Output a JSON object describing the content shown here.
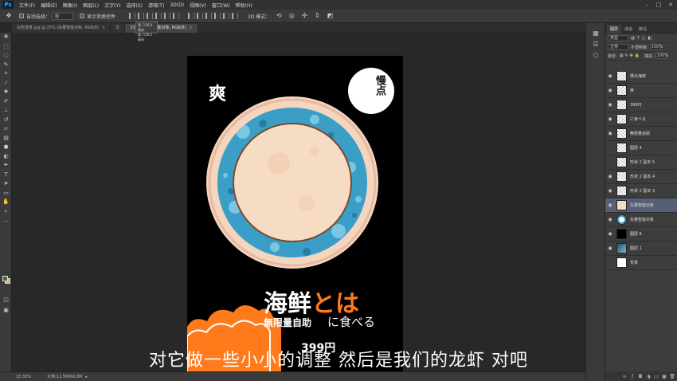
{
  "app": {
    "logo": "Ps"
  },
  "menu": [
    "文件(F)",
    "编辑(E)",
    "图像(I)",
    "图层(L)",
    "文字(Y)",
    "选择(S)",
    "滤镜(T)",
    "3D(D)",
    "视图(V)",
    "窗口(W)",
    "帮助(H)"
  ],
  "options": {
    "auto_select_label": "自动选择：",
    "auto_select_value": "组",
    "show_transform_label": "显示变换控件",
    "mode_3d_label": "3D 模式："
  },
  "tabs": [
    {
      "label": "白色背景.jpg @ 25% (矢量智能对象, RGB/8)",
      "active": false
    },
    {
      "label": "文",
      "active": false
    },
    {
      "label": "33.3% (矢量智能对象, RGB/8)",
      "active": true
    }
  ],
  "tooltip": {
    "line1": "宽: 116.0 毫米",
    "line2": "高: 126.2 毫米"
  },
  "toolbar": {
    "icons": [
      "move-icon",
      "marquee-icon",
      "lasso-icon",
      "quick-select-icon",
      "crop-icon",
      "eyedropper-icon",
      "healing-icon",
      "brush-icon",
      "stamp-icon",
      "history-brush-icon",
      "eraser-icon",
      "gradient-icon",
      "blur-icon",
      "dodge-icon",
      "pen-icon",
      "type-icon",
      "path-select-icon",
      "shape-icon",
      "hand-icon",
      "zoom-icon",
      "more-icon"
    ],
    "fg_color": "#2b7a3a",
    "bg_color": "#e0b070"
  },
  "poster": {
    "corner_char": "爽",
    "logo_text": "慢点",
    "headline_main": "海鲜",
    "headline_accent": "とは",
    "sub_left": "無限量自助",
    "sub_right": "に食べる",
    "price": "399円",
    "accent_color": "#ff7a1a",
    "ring_color": "#3a9ec7",
    "plate_color": "#f6dcc5"
  },
  "status": {
    "zoom": "33.33%",
    "doc": "文档:12.5M/66.8M"
  },
  "panel": {
    "tabs": [
      "图层",
      "通道",
      "路径"
    ],
    "kind_label": "类型",
    "blend_mode": "正常",
    "opacity_label": "不透明度:",
    "opacity_value": "100%",
    "lock_label": "锁定:",
    "fill_label": "填充:",
    "fill_value": "100%",
    "layers": [
      {
        "name": "慢点海鲜",
        "visible": true,
        "thumb": "logo"
      },
      {
        "name": "爽",
        "visible": true,
        "thumb": "checker"
      },
      {
        "name": "399円",
        "visible": true,
        "thumb": "checker"
      },
      {
        "name": "に食べる",
        "visible": true,
        "thumb": "checker"
      },
      {
        "name": "無限量自助",
        "visible": true,
        "thumb": "checker"
      },
      {
        "name": "图层 4",
        "visible": false,
        "thumb": "checker"
      },
      {
        "name": "形状 2 副本 5",
        "visible": false,
        "thumb": "checker"
      },
      {
        "name": "形状 2 副本 4",
        "visible": true,
        "thumb": "checker"
      },
      {
        "name": "形状 2 副本 3",
        "visible": true,
        "thumb": "checker"
      },
      {
        "name": "矢量智能对象",
        "visible": true,
        "thumb": "plate",
        "selected": true
      },
      {
        "name": "矢量智能对象",
        "visible": true,
        "thumb": "ring"
      },
      {
        "name": "图层 6",
        "visible": true,
        "thumb": "black"
      },
      {
        "name": "图层 1",
        "visible": true,
        "thumb": "gradient"
      },
      {
        "name": "背景",
        "visible": false,
        "thumb": "white"
      }
    ]
  },
  "subtitle": "对它做一些小小的调整 然后是我们的龙虾 对吧"
}
